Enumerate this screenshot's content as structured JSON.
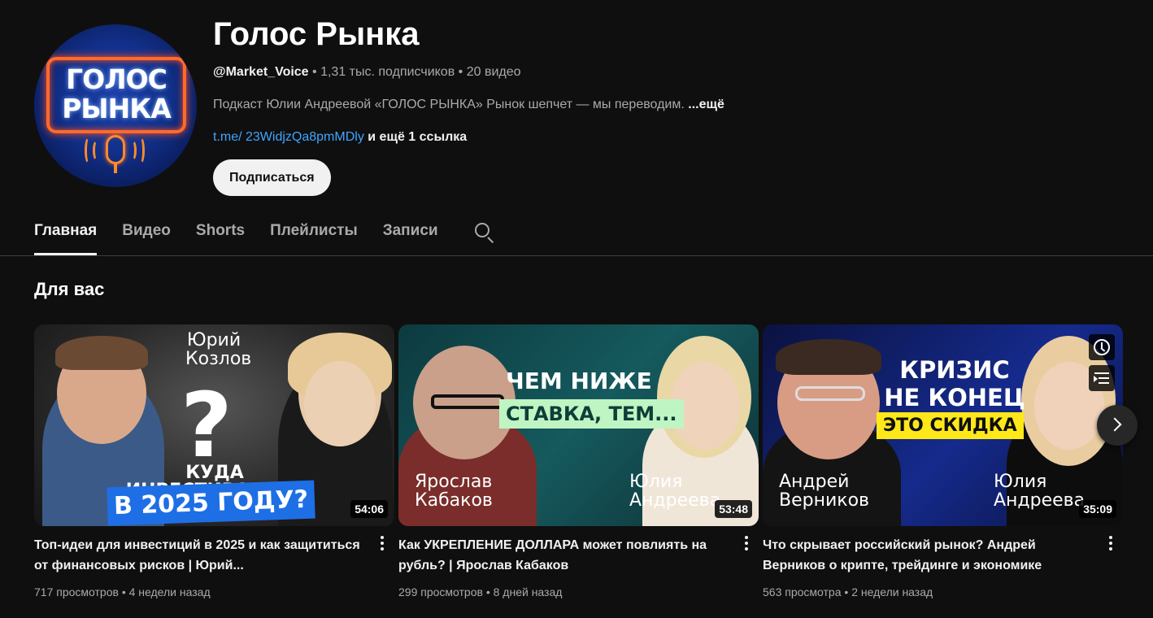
{
  "channel": {
    "title": "Голос Рынка",
    "handle": "@Market_Voice",
    "subscribers": "1,31 тыс. подписчиков",
    "videos_count": "20 видео",
    "separator": " • ",
    "description": "Подкаст Юлии Андреевой «ГОЛОС РЫНКА» Рынок шепчет — мы переводим.",
    "more_label": "...ещё",
    "link": "t.me/ 23WidjzQa8pmMDly",
    "extra_links": " и ещё 1 ссылка",
    "subscribe_label": "Подписаться",
    "avatar_text_line1": "ГОЛОС",
    "avatar_text_line2": "РЫНКА"
  },
  "tabs": [
    {
      "label": "Главная",
      "active": true
    },
    {
      "label": "Видео",
      "active": false
    },
    {
      "label": "Shorts",
      "active": false
    },
    {
      "label": "Плейлисты",
      "active": false
    },
    {
      "label": "Записи",
      "active": false
    }
  ],
  "section": {
    "title": "Для вас"
  },
  "videos": [
    {
      "title": "Топ-идеи для инвестиций в 2025 и как защититься от финансовых рисков | Юрий...",
      "views": "717 просмотров",
      "age": "4 недели назад",
      "duration": "54:06",
      "thumb": {
        "name_top": "Юрий Козлов",
        "question": "?",
        "caption_line1": "КУДА ИНВЕСТИРОВАТЬ",
        "caption_line2": "В 2025 ГОДУ?"
      }
    },
    {
      "title": "Как УКРЕПЛЕНИЕ ДОЛЛАРА может повлиять на рубль? | Ярослав Кабаков",
      "views": "299 просмотров",
      "age": "8 дней назад",
      "duration": "53:48",
      "thumb": {
        "caption_line1": "ЧЕМ НИЖЕ",
        "caption_line2": "СТАВКА, ТЕМ...",
        "name_left": "Ярослав Кабаков",
        "name_right": "Юлия Андреева"
      }
    },
    {
      "title": "Что скрывает российский рынок? Андрей Верников о крипте, трейдинге и экономике",
      "views": "563 просмотра",
      "age": "2 недели назад",
      "duration": "35:09",
      "thumb": {
        "caption_line1": "КРИЗИС",
        "caption_line2": "НЕ КОНЕЦ",
        "caption_line3": "ЭТО СКИДКА",
        "name_left": "Андрей Верников",
        "name_right": "Юлия Андреева"
      }
    }
  ],
  "icons": {
    "search": "search-icon",
    "more": "more-vert-icon",
    "watch_later": "clock-icon",
    "add_to_queue": "queue-icon",
    "next": "chevron-right-icon"
  },
  "colors": {
    "background": "#0f0f0f",
    "link": "#3ea6ff",
    "subscribe_bg": "#f1f1f1",
    "secondary_text": "#aaaaaa"
  }
}
